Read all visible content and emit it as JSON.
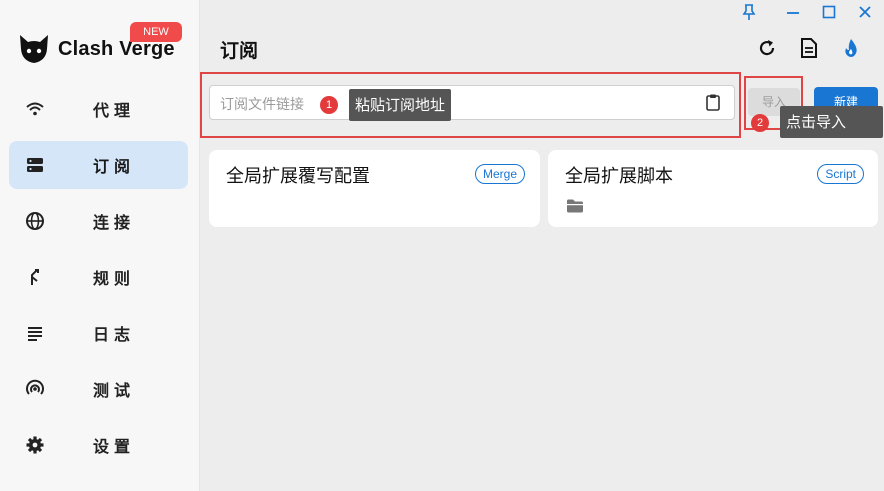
{
  "app": {
    "logo_text": "Clash Verge",
    "badge": "NEW"
  },
  "sidebar": {
    "items": [
      {
        "label": "代理",
        "icon": "wifi-icon",
        "active": false
      },
      {
        "label": "订阅",
        "icon": "server-icon",
        "active": true
      },
      {
        "label": "连接",
        "icon": "globe-icon",
        "active": false
      },
      {
        "label": "规则",
        "icon": "fork-arrow-icon",
        "active": false
      },
      {
        "label": "日志",
        "icon": "list-lines-icon",
        "active": false
      },
      {
        "label": "测试",
        "icon": "signal-icon",
        "active": false
      },
      {
        "label": "设置",
        "icon": "gear-icon",
        "active": false
      }
    ]
  },
  "header": {
    "title": "订阅"
  },
  "toolbar": {
    "url_placeholder": "订阅文件链接",
    "import_label": "导入",
    "new_label": "新建"
  },
  "callouts": [
    {
      "number": "1",
      "text": "粘贴订阅地址"
    },
    {
      "number": "2",
      "text": "点击导入"
    }
  ],
  "cards": [
    {
      "title": "全局扩展覆写配置",
      "tag": "Merge"
    },
    {
      "title": "全局扩展脚本",
      "tag": "Script"
    }
  ],
  "colors": {
    "accent": "#1976d2",
    "highlight_frame": "#e04545",
    "active_nav_bg": "#d5e6f8"
  }
}
